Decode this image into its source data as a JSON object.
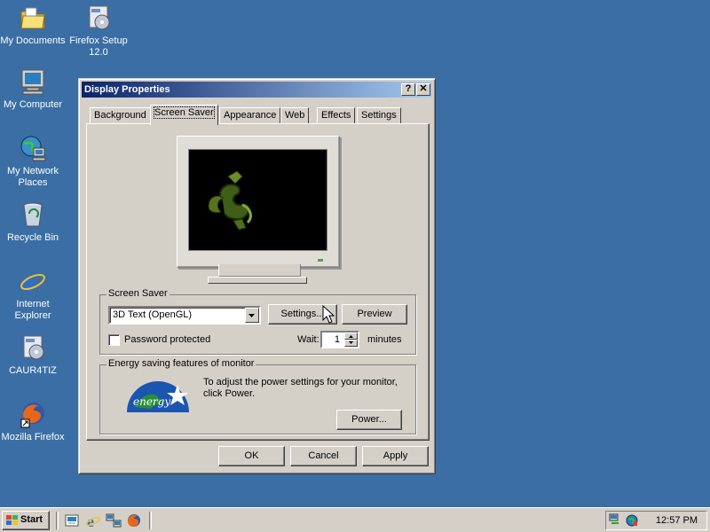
{
  "desktop": {
    "icons": [
      {
        "label": "My Documents",
        "icon": "folder-icon"
      },
      {
        "label": "Firefox Setup 12.0",
        "icon": "installer-icon"
      },
      {
        "label": "My Computer",
        "icon": "computer-icon"
      },
      {
        "label": "My Network Places",
        "icon": "network-icon"
      },
      {
        "label": "Recycle Bin",
        "icon": "recycle-bin-icon"
      },
      {
        "label": "Internet Explorer",
        "icon": "ie-icon"
      },
      {
        "label": "CAUR4TIZ",
        "icon": "installer-icon"
      },
      {
        "label": "Mozilla Firefox",
        "icon": "firefox-icon"
      }
    ]
  },
  "dialog": {
    "title": "Display Properties",
    "help_button": "?",
    "close_button": "✕",
    "tabs": [
      "Background",
      "Screen Saver",
      "Appearance",
      "Web",
      "Effects",
      "Settings"
    ],
    "active_tab": "Screen Saver",
    "screen_saver": {
      "group_title": "Screen Saver",
      "selected": "3D Text (OpenGL)",
      "settings_button": "Settings...",
      "preview_button": "Preview",
      "password_label": "Password protected",
      "password_checked": false,
      "wait_label": "Wait:",
      "wait_value": "1",
      "minutes_label": "minutes"
    },
    "energy": {
      "group_title": "Energy saving features of monitor",
      "text": "To adjust the power settings for your monitor, click Power.",
      "power_button": "Power...",
      "logo_text": "energy"
    },
    "ok_button": "OK",
    "cancel_button": "Cancel",
    "apply_button": "Apply"
  },
  "taskbar": {
    "start_label": "Start",
    "quick_launch": [
      "show-desktop-icon",
      "ie-icon",
      "network-icon",
      "firefox-icon"
    ],
    "clock": "12:57 PM"
  },
  "colors": {
    "desktop": "#3a6ea5",
    "title_active_start": "#0a246a",
    "title_active_end": "#a6caf0",
    "face": "#d4d0c8"
  }
}
